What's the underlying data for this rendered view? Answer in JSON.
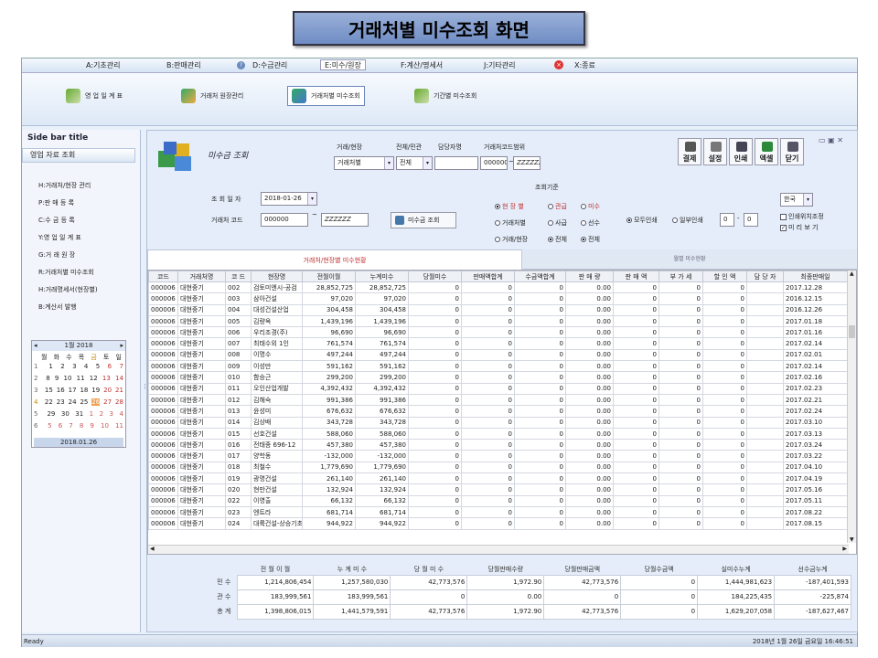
{
  "slide_title": "거래처별 미수조회 화면",
  "menus": [
    "A:기초관리",
    "B:판매관리",
    "D:수금관리",
    "E:미수/원장",
    "F:계산/명세서",
    "J:기타관리",
    "X:종료"
  ],
  "ribbon": [
    "영 업 일 계 표",
    "거래처 원장관리",
    "거래처별 미수조회",
    "기간별 미수조회"
  ],
  "sidebar": {
    "title": "Side bar title",
    "header": "영업 자료 조회",
    "items": [
      "H:거래처/현장 관리",
      "P:판 매 등 록",
      "C:수 금 등 록",
      "Y:영 업 일 계 표",
      "G:거 래 원 장",
      "R:거래처별 미수조회",
      "H:거래명세서(현장별)",
      "B:계산서 발행"
    ]
  },
  "calendar": {
    "month": "1월 2018",
    "weekdays": [
      "월",
      "화",
      "수",
      "목",
      "금",
      "토",
      "일"
    ],
    "weeks": [
      [
        "1",
        "2",
        "3",
        "4",
        "5",
        "6",
        "7"
      ],
      [
        "8",
        "9",
        "10",
        "11",
        "12",
        "13",
        "14"
      ],
      [
        "15",
        "16",
        "17",
        "18",
        "19",
        "20",
        "21"
      ],
      [
        "22",
        "23",
        "24",
        "25",
        "26",
        "27",
        "28"
      ],
      [
        "29",
        "30",
        "31",
        "1",
        "2",
        "3",
        "4"
      ],
      [
        "5",
        "6",
        "7",
        "8",
        "9",
        "10",
        "11"
      ]
    ],
    "weeknums": [
      "1",
      "2",
      "3",
      "4",
      "5",
      "6"
    ],
    "footer": "2018.01.26"
  },
  "main": {
    "title": "미수금 조회",
    "labels": {
      "site": "거래/현장",
      "all_by": "전체/민관",
      "person": "담당자명",
      "code_range": "거래처코드범위",
      "date": "조 회 일 자",
      "code": "거래처 코드",
      "basis": "조회기준"
    },
    "values": {
      "site": "거래처별",
      "all_by": "전체",
      "code_from": "000000",
      "code_to": "ZZZZZZ",
      "date": "2018-01-26",
      "code": "000000",
      "code2": "ZZZZZZ",
      "tilde1": "~",
      "tilde2": "~"
    },
    "query_button": "미수금 조회",
    "tools": [
      "결제",
      "설정",
      "인쇄",
      "엑셀",
      "닫기"
    ],
    "radios": {
      "r1": [
        "현 장 별",
        "거래처별",
        "거래/현장"
      ],
      "r2": [
        "관급",
        "사급",
        "전체"
      ],
      "r3": [
        "미수",
        "선수",
        "전체"
      ],
      "print": [
        "모두인쇄",
        "일부인쇄"
      ]
    },
    "page_from": "0",
    "page_to": "0",
    "page_dash": "-",
    "lang": "한국",
    "checks": [
      "인쇄위치조정",
      "미 리 보 기"
    ],
    "tab_active": "거래처/현장별 미수현황",
    "tab_other": "월별 미수현황"
  },
  "table": {
    "headers": [
      "코드",
      "거래처명",
      "코 드",
      "현장명",
      "전월이월",
      "누계미수",
      "당월미수",
      "판매액합계",
      "수금액합계",
      "판 매 량",
      "판 매 액",
      "부 가 세",
      "할 인 액",
      "담 당 자",
      "최종판매일"
    ],
    "rows": [
      [
        "000006",
        "대현중기",
        "002",
        "검토미엔시-공검",
        "28,852,725",
        "28,852,725",
        "0",
        "0",
        "0",
        "0.00",
        "0",
        "0",
        "0",
        "",
        "2017.12.28"
      ],
      [
        "000006",
        "대현중기",
        "003",
        "삼아건설",
        "97,020",
        "97,020",
        "0",
        "0",
        "0",
        "0.00",
        "0",
        "0",
        "0",
        "",
        "2016.12.15"
      ],
      [
        "000006",
        "대현중기",
        "004",
        "대성건설산업",
        "304,458",
        "304,458",
        "0",
        "0",
        "0",
        "0.00",
        "0",
        "0",
        "0",
        "",
        "2016.12.26"
      ],
      [
        "000006",
        "대현중기",
        "005",
        "김량옥",
        "1,439,196",
        "1,439,196",
        "0",
        "0",
        "0",
        "0.00",
        "0",
        "0",
        "0",
        "",
        "2017.01.18"
      ],
      [
        "000006",
        "대현중기",
        "006",
        "우리조경(주)",
        "96,690",
        "96,690",
        "0",
        "0",
        "0",
        "0.00",
        "0",
        "0",
        "0",
        "",
        "2017.01.16"
      ],
      [
        "000006",
        "대현중기",
        "007",
        "최태수외 1인",
        "761,574",
        "761,574",
        "0",
        "0",
        "0",
        "0.00",
        "0",
        "0",
        "0",
        "",
        "2017.02.14"
      ],
      [
        "000006",
        "대현중기",
        "008",
        "이명수",
        "497,244",
        "497,244",
        "0",
        "0",
        "0",
        "0.00",
        "0",
        "0",
        "0",
        "",
        "2017.02.01"
      ],
      [
        "000006",
        "대현중기",
        "009",
        "이성만",
        "591,162",
        "591,162",
        "0",
        "0",
        "0",
        "0.00",
        "0",
        "0",
        "0",
        "",
        "2017.02.14"
      ],
      [
        "000006",
        "대현중기",
        "010",
        "함승근",
        "299,200",
        "299,200",
        "0",
        "0",
        "0",
        "0.00",
        "0",
        "0",
        "0",
        "",
        "2017.02.16"
      ],
      [
        "000006",
        "대현중기",
        "011",
        "오인산업개발",
        "4,392,432",
        "4,392,432",
        "0",
        "0",
        "0",
        "0.00",
        "0",
        "0",
        "0",
        "",
        "2017.02.23"
      ],
      [
        "000006",
        "대현중기",
        "012",
        "김해숙",
        "991,386",
        "991,386",
        "0",
        "0",
        "0",
        "0.00",
        "0",
        "0",
        "0",
        "",
        "2017.02.21"
      ],
      [
        "000006",
        "대현중기",
        "013",
        "윤성미",
        "676,632",
        "676,632",
        "0",
        "0",
        "0",
        "0.00",
        "0",
        "0",
        "0",
        "",
        "2017.02.24"
      ],
      [
        "000006",
        "대현중기",
        "014",
        "김상배",
        "343,728",
        "343,728",
        "0",
        "0",
        "0",
        "0.00",
        "0",
        "0",
        "0",
        "",
        "2017.03.10"
      ],
      [
        "000006",
        "대현중기",
        "015",
        "선호건설",
        "588,060",
        "588,060",
        "0",
        "0",
        "0",
        "0.00",
        "0",
        "0",
        "0",
        "",
        "2017.03.13"
      ],
      [
        "000006",
        "대현중기",
        "016",
        "전태종 696-12",
        "457,380",
        "457,380",
        "0",
        "0",
        "0",
        "0.00",
        "0",
        "0",
        "0",
        "",
        "2017.03.24"
      ],
      [
        "000006",
        "대현중기",
        "017",
        "양학동",
        "-132,000",
        "-132,000",
        "0",
        "0",
        "0",
        "0.00",
        "0",
        "0",
        "0",
        "",
        "2017.03.22"
      ],
      [
        "000006",
        "대현중기",
        "018",
        "최철수",
        "1,779,690",
        "1,779,690",
        "0",
        "0",
        "0",
        "0.00",
        "0",
        "0",
        "0",
        "",
        "2017.04.10"
      ],
      [
        "000006",
        "대현중기",
        "019",
        "광명건설",
        "261,140",
        "261,140",
        "0",
        "0",
        "0",
        "0.00",
        "0",
        "0",
        "0",
        "",
        "2017.04.19"
      ],
      [
        "000006",
        "대현중기",
        "020",
        "현만건설",
        "132,924",
        "132,924",
        "0",
        "0",
        "0",
        "0.00",
        "0",
        "0",
        "0",
        "",
        "2017.05.16"
      ],
      [
        "000006",
        "대현중기",
        "022",
        "이영출",
        "66,132",
        "66,132",
        "0",
        "0",
        "0",
        "0.00",
        "0",
        "0",
        "0",
        "",
        "2017.05.11"
      ],
      [
        "000006",
        "대현중기",
        "023",
        "엔트라",
        "681,714",
        "681,714",
        "0",
        "0",
        "0",
        "0.00",
        "0",
        "0",
        "0",
        "",
        "2017.08.22"
      ],
      [
        "000006",
        "대현중기",
        "024",
        "대륙건설-상승기초",
        "944,922",
        "944,922",
        "0",
        "0",
        "0",
        "0.00",
        "0",
        "0",
        "0",
        "",
        "2017.08.15"
      ]
    ]
  },
  "summary": {
    "headers": [
      "전 월 이 월",
      "누 계 미 수",
      "당 월 미 수",
      "당월판매수량",
      "당월판매금액",
      "당월수금액",
      "실미수누계",
      "선수금누계"
    ],
    "rows": [
      {
        "label": "민 수",
        "values": [
          "1,214,806,454",
          "1,257,580,030",
          "42,773,576",
          "1,972.90",
          "42,773,576",
          "0",
          "1,444,981,623",
          "-187,401,593"
        ]
      },
      {
        "label": "관 수",
        "values": [
          "183,999,561",
          "183,999,561",
          "0",
          "0.00",
          "0",
          "0",
          "184,225,435",
          "-225,874"
        ]
      },
      {
        "label": "총 계",
        "values": [
          "1,398,806,015",
          "1,441,579,591",
          "42,773,576",
          "1,972.90",
          "42,773,576",
          "0",
          "1,629,207,058",
          "-187,627,467"
        ]
      }
    ]
  },
  "status": {
    "left": "Ready",
    "right": "2018년 1월 26일 금요일 16:46:51"
  }
}
